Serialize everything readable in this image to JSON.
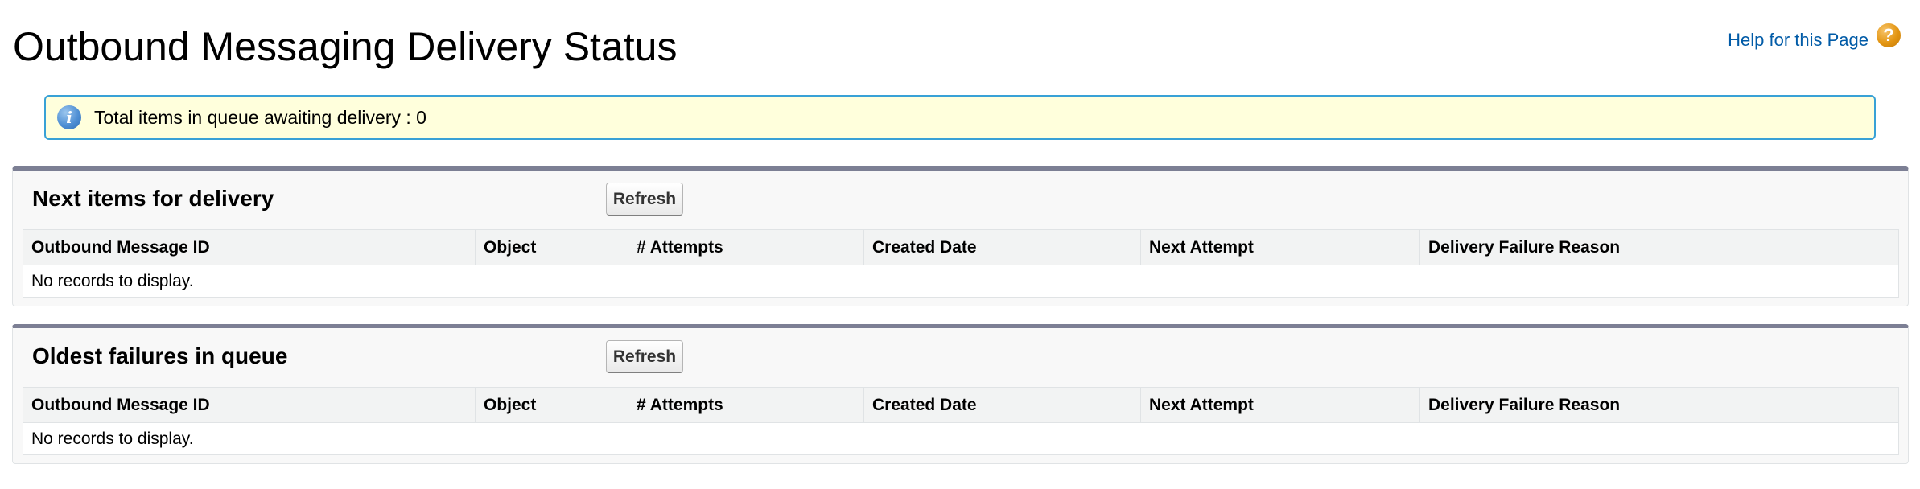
{
  "page": {
    "title": "Outbound Messaging Delivery Status",
    "help_label": "Help for this Page",
    "help_icon": "help-icon"
  },
  "info": {
    "icon": "info-icon",
    "message": "Total items in queue awaiting delivery : 0"
  },
  "sections": [
    {
      "title": "Next items for delivery",
      "refresh_label": "Refresh",
      "columns": [
        "Outbound Message ID",
        "Object",
        "# Attempts",
        "Created Date",
        "Next Attempt",
        "Delivery Failure Reason"
      ],
      "empty_text": "No records to display."
    },
    {
      "title": "Oldest failures in queue",
      "refresh_label": "Refresh",
      "columns": [
        "Outbound Message ID",
        "Object",
        "# Attempts",
        "Created Date",
        "Next Attempt",
        "Delivery Failure Reason"
      ],
      "empty_text": "No records to display."
    }
  ],
  "colors": {
    "link": "#015ba7",
    "info_background": "#ffffdc",
    "info_border": "#39a1d6",
    "section_top_border": "#7c7f94",
    "help_icon": "#e39512"
  }
}
